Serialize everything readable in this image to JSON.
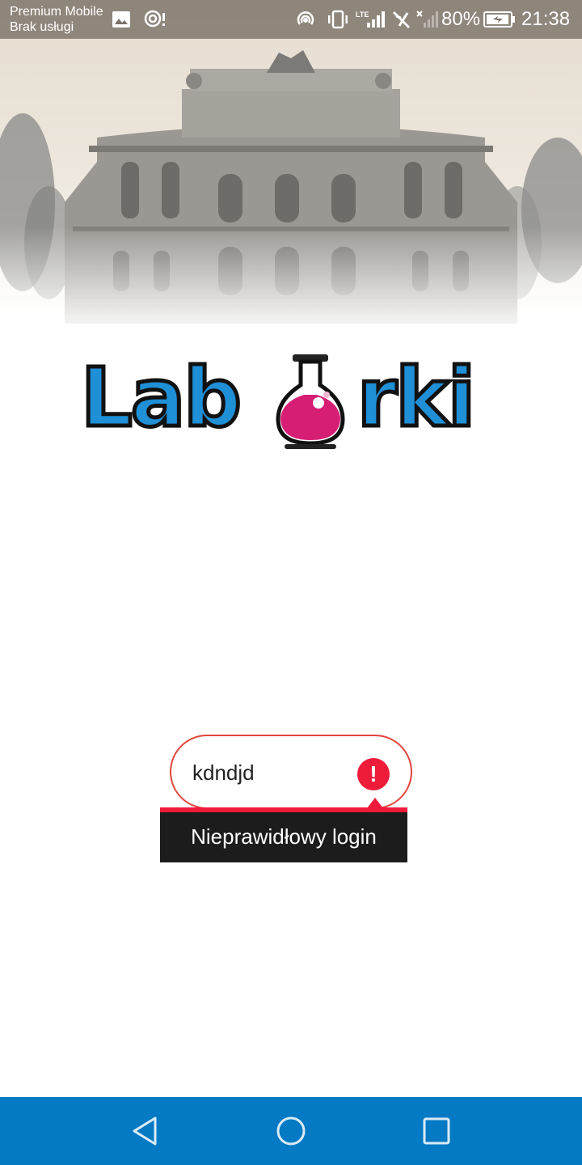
{
  "status_bar": {
    "carrier_line1": "Premium Mobile",
    "carrier_line2": "Brak usługi",
    "battery": "80%",
    "time": "21:38",
    "icons": [
      "image-icon",
      "portable-wifi-icon",
      "hotspot-icon",
      "vibrate-icon",
      "lte-signal-icon",
      "no-sim-icon",
      "signal-x-icon",
      "battery-charging-icon"
    ]
  },
  "logo": {
    "text_left": "Lab",
    "text_right": "rki",
    "flask_color": "#d61e74",
    "letter_color": "#1f8fd6"
  },
  "login": {
    "value": "kdndjd",
    "error_icon": "error-exclamation-icon",
    "error_text": "Nieprawidłowy login",
    "error_color": "#ef1b3a"
  },
  "nav_bar": {
    "color": "#0479c4",
    "buttons": [
      "back-icon",
      "home-icon",
      "recents-icon"
    ]
  }
}
